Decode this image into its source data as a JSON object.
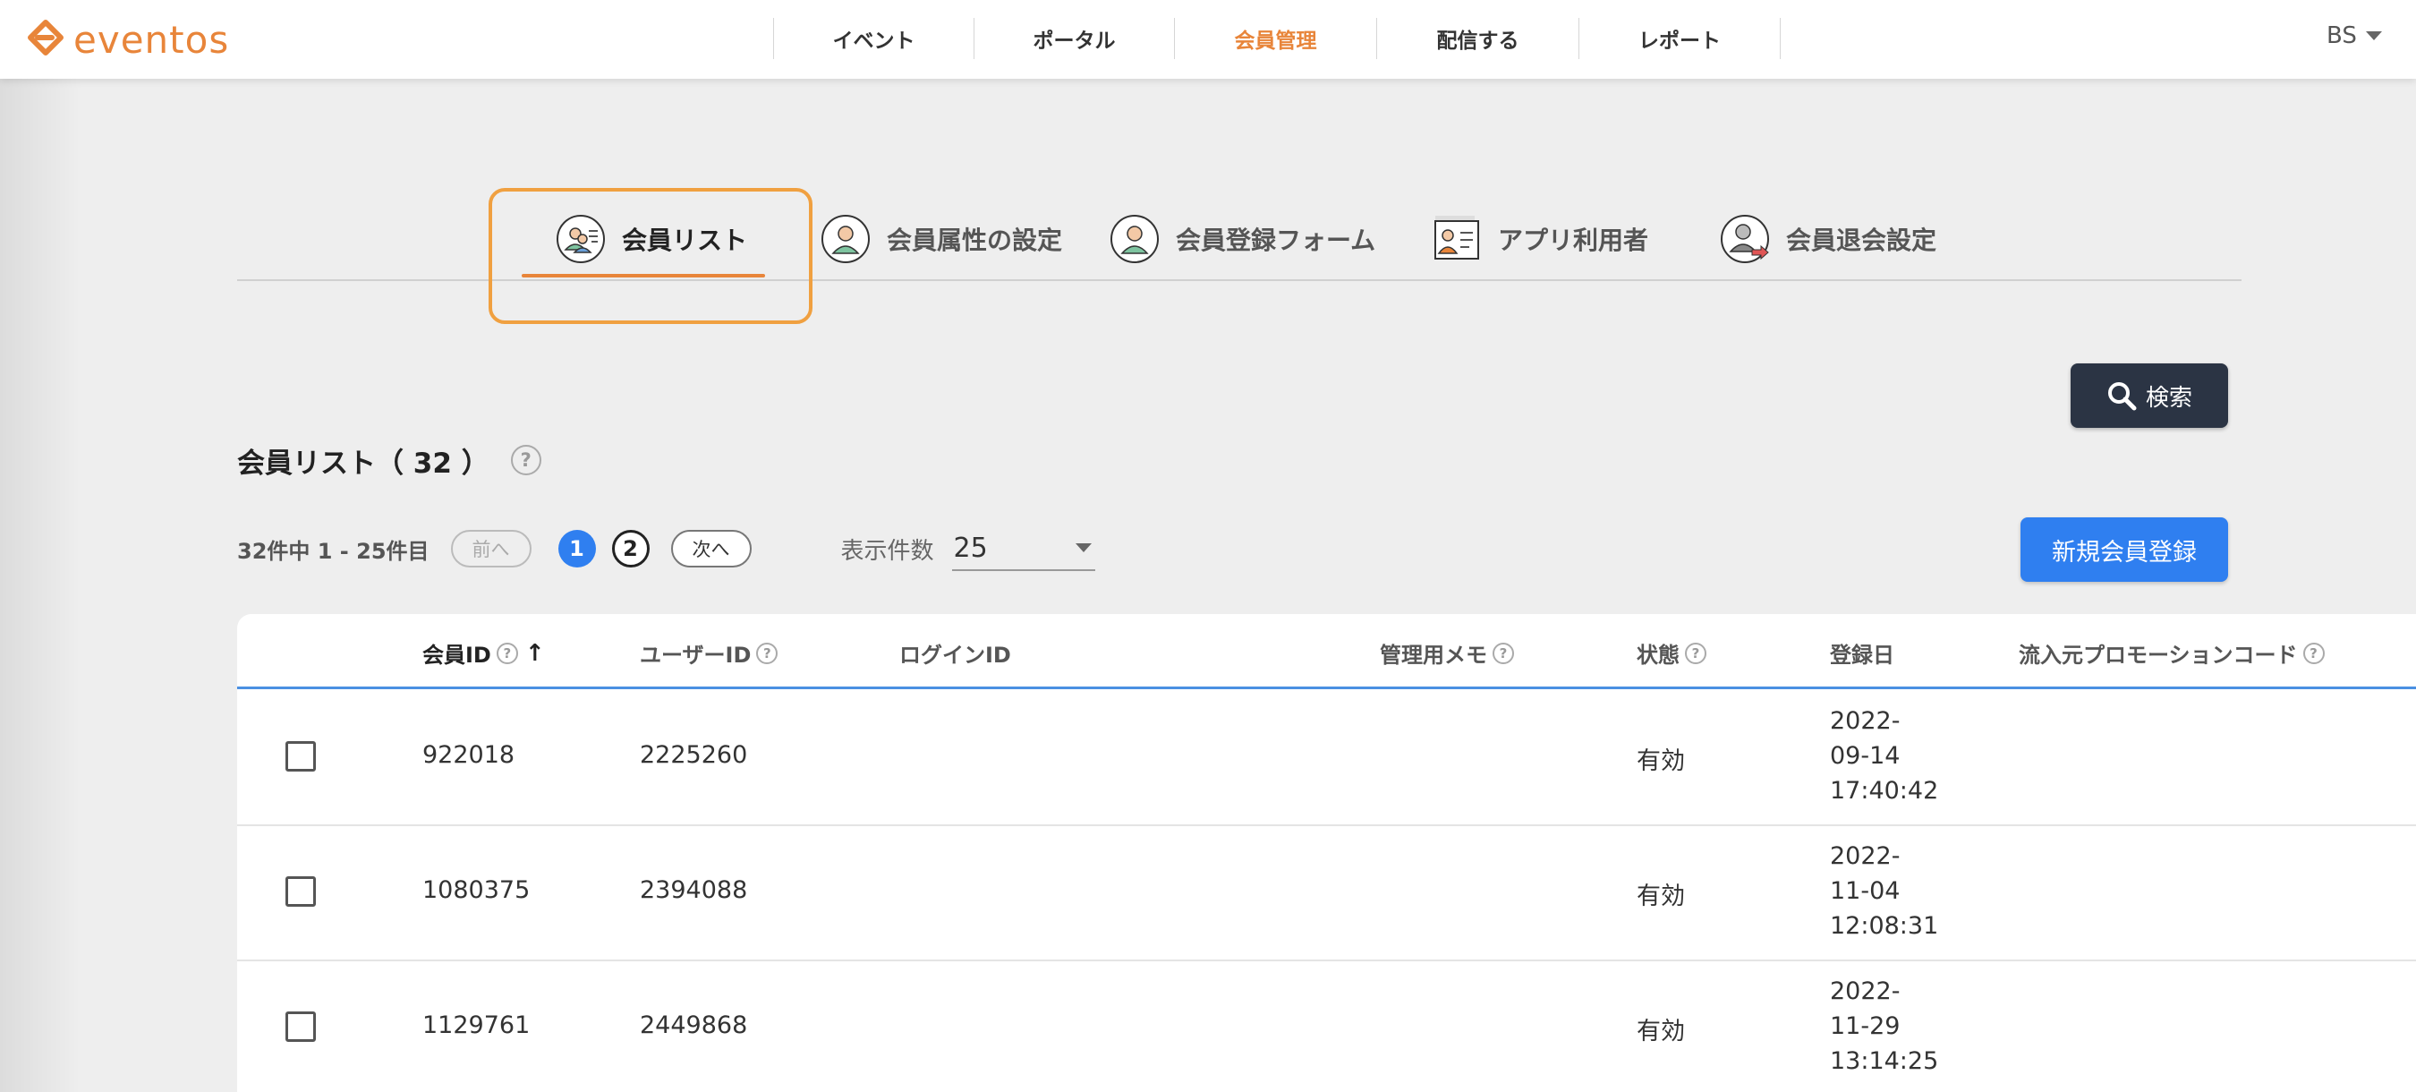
{
  "header": {
    "logo_text": "eventos",
    "nav": [
      {
        "label": "イベント",
        "active": false
      },
      {
        "label": "ポータル",
        "active": false
      },
      {
        "label": "会員管理",
        "active": true
      },
      {
        "label": "配信する",
        "active": false
      },
      {
        "label": "レポート",
        "active": false
      }
    ],
    "user_initials": "BS"
  },
  "tabs": [
    {
      "label": "会員リスト",
      "icon": "member-list-icon",
      "active": true
    },
    {
      "label": "会員属性の設定",
      "icon": "member-attribute-icon",
      "active": false
    },
    {
      "label": "会員登録フォーム",
      "icon": "member-form-icon",
      "active": false
    },
    {
      "label": "アプリ利用者",
      "icon": "app-user-icon",
      "active": false
    },
    {
      "label": "会員退会設定",
      "icon": "member-withdraw-icon",
      "active": false
    }
  ],
  "search_button": {
    "label": "検索",
    "icon": "search-icon"
  },
  "section": {
    "title": "会員リスト（ 32 ）",
    "help": "?"
  },
  "pagination": {
    "summary": "32件中 1 - 25件目",
    "prev_label": "前へ",
    "pages": [
      "1",
      "2"
    ],
    "current_page": "1",
    "next_label": "次へ",
    "per_page_label": "表示件数",
    "per_page_value": "25"
  },
  "register_button": {
    "label": "新規会員登録"
  },
  "table": {
    "columns": [
      {
        "label": "会員ID",
        "help": true,
        "sorted": true
      },
      {
        "label": "ユーザーID",
        "help": true,
        "sorted": false
      },
      {
        "label": "ログインID",
        "help": false,
        "sorted": false
      },
      {
        "label": "管理用メモ",
        "help": true,
        "sorted": false
      },
      {
        "label": "状態",
        "help": true,
        "sorted": false
      },
      {
        "label": "登録日",
        "help": false,
        "sorted": false
      },
      {
        "label": "流入元プロモーションコード",
        "help": true,
        "sorted": false
      }
    ],
    "rows": [
      {
        "member_id": "922018",
        "user_id": "2225260",
        "login_id": "",
        "memo": "",
        "status": "有効",
        "date_lines": [
          "2022-",
          "09-14",
          "17:40:42"
        ],
        "promo": ""
      },
      {
        "member_id": "1080375",
        "user_id": "2394088",
        "login_id": "",
        "memo": "",
        "status": "有効",
        "date_lines": [
          "2022-",
          "11-04",
          "12:08:31"
        ],
        "promo": ""
      },
      {
        "member_id": "1129761",
        "user_id": "2449868",
        "login_id": "",
        "memo": "",
        "status": "有効",
        "date_lines": [
          "2022-",
          "11-29",
          "13:14:25"
        ],
        "promo": ""
      }
    ],
    "sort_indicator": "↑"
  },
  "colors": {
    "brand": "#e8853a",
    "primary": "#2f7ff0",
    "dark_button": "#2b3444",
    "highlight": "#f0a040"
  }
}
